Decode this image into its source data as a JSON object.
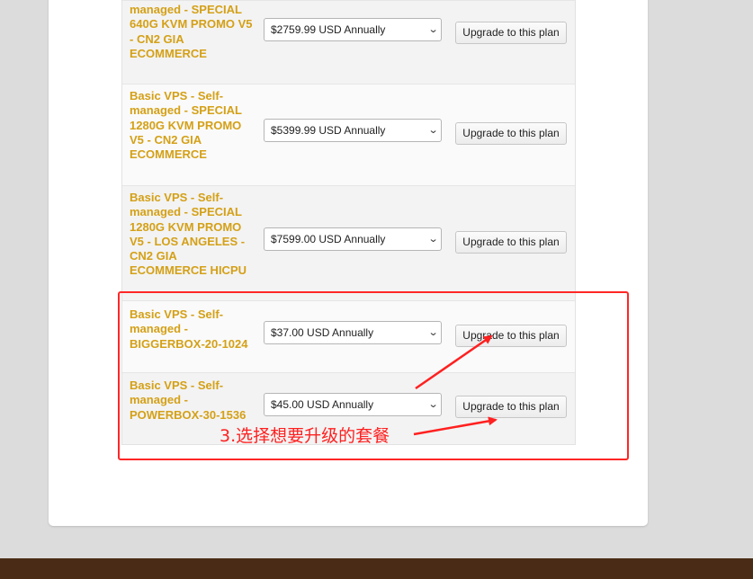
{
  "plans": [
    {
      "name": "managed - SPECIAL 640G KVM PROMO V5 - CN2 GIA ECOMMERCE",
      "price": "$2759.99 USD Annually",
      "button": "Upgrade to this plan"
    },
    {
      "name": "Basic VPS - Self-managed - SPECIAL 1280G KVM PROMO V5 - CN2 GIA ECOMMERCE",
      "price": "$5399.99 USD Annually",
      "button": "Upgrade to this plan"
    },
    {
      "name": "Basic VPS - Self-managed - SPECIAL 1280G KVM PROMO V5 - LOS ANGELES - CN2 GIA ECOMMERCE HICPU",
      "price": "$7599.00 USD Annually",
      "button": "Upgrade to this plan"
    },
    {
      "name": "Basic VPS - Self-managed - BIGGERBOX-20-1024",
      "price": "$37.00 USD Annually",
      "button": "Upgrade to this plan"
    },
    {
      "name": "Basic VPS - Self-managed - POWERBOX-30-1536",
      "price": "$45.00 USD Annually",
      "button": "Upgrade to this plan"
    }
  ],
  "annotation": {
    "text": "3.选择想要升级的套餐",
    "color": "#ff2020"
  },
  "colors": {
    "plan_name": "#d4a017",
    "footer": "#4a2c16",
    "background": "#dcdcdc"
  },
  "icons": {
    "select_chevron": "chevron-down-icon"
  }
}
